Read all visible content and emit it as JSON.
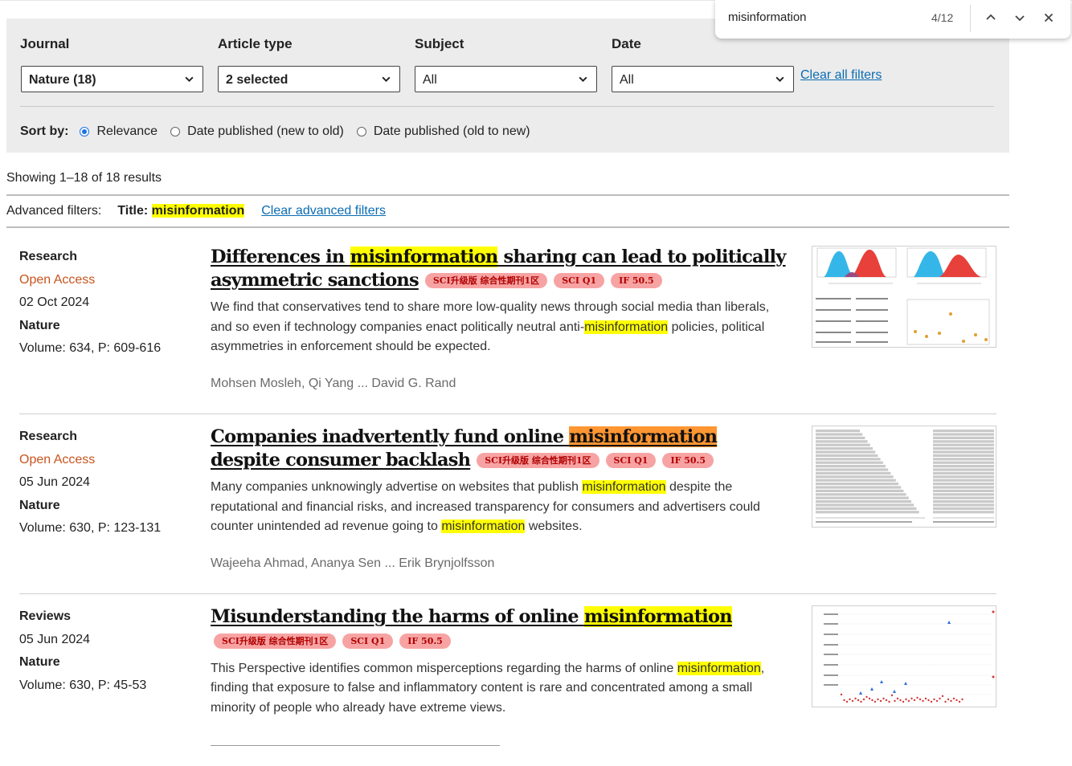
{
  "find_bar": {
    "query": "misinformation",
    "count": "4/12"
  },
  "filters": {
    "journal": {
      "label": "Journal",
      "value": "Nature (18)"
    },
    "article_type": {
      "label": "Article type",
      "value": "2 selected"
    },
    "subject": {
      "label": "Subject",
      "value": "All"
    },
    "date": {
      "label": "Date",
      "value": "All"
    },
    "clear_all": "Clear all filters",
    "sort_by_label": "Sort by:",
    "sort_options": [
      "Relevance",
      "Date published (new to old)",
      "Date published (old to new)"
    ],
    "sort_selected": "Relevance"
  },
  "results_summary": "Showing 1–18 of 18 results",
  "advanced_filters": {
    "label": "Advanced filters:",
    "title_label": "Title:",
    "title_value": "misinformation",
    "clear": "Clear advanced filters"
  },
  "articles": [
    {
      "type": "Research",
      "access": "Open Access",
      "date": "02 Oct 2024",
      "journal": "Nature",
      "volume": "Volume: 634, P: 609-616",
      "title_before": "Differences in ",
      "title_highlight": "misinformation",
      "title_after": " sharing can lead to politically asymmetric sanctions",
      "badges": [
        "SCI升级版 综合性期刊1区",
        "SCI Q1",
        "IF 50.5"
      ],
      "summary_1": "We find that conservatives tend to share more low-quality news through social media than liberals, and so even if technology companies enact politically neutral anti-",
      "summary_hl_1": "misinformation",
      "summary_2": " policies, political asymmetries in enforcement should be expected.",
      "authors": "Mohsen Mosleh, Qi Yang ... David G. Rand",
      "thumbnail": "density-plots-and-table-figure"
    },
    {
      "type": "Research",
      "access": "Open Access",
      "date": "05 Jun 2024",
      "journal": "Nature",
      "volume": "Volume: 630, P: 123-131",
      "title_before": "Companies inadvertently fund online ",
      "title_highlight": "misinformation",
      "title_after": " despite consumer backlash",
      "badges": [
        "SCI升级版 综合性期刊1区",
        "SCI Q1",
        "IF 50.5"
      ],
      "summary_1": "Many companies unknowingly advertise on websites that publish ",
      "summary_hl_1": "misinformation",
      "summary_2": " despite the reputational and financial risks, and increased transparency for consumers and advertisers could counter unintended ad revenue going to ",
      "summary_hl_2": "misinformation",
      "summary_3": " websites.",
      "authors": "Wajeeha Ahmad, Ananya Sen ... Erik Brynjolfsson",
      "thumbnail": "horizontal-bar-chart-figure"
    },
    {
      "type": "Reviews",
      "date": "05 Jun 2024",
      "journal": "Nature",
      "volume": "Volume: 630, P: 45-53",
      "title_before": "Misunderstanding the harms of online ",
      "title_highlight": "misinformation",
      "badges": [
        "SCI升级版 综合性期刊1区",
        "SCI Q1",
        "IF 50.5"
      ],
      "summary_1": "This Perspective identifies common misperceptions regarding the harms of online ",
      "summary_hl_1": "misinformation",
      "summary_2": ", finding that exposure to false and inflammatory content is rare and concentrated among a small minority of people who already have extreme views.",
      "thumbnail": "scatter-plot-figure"
    }
  ],
  "colors": {
    "highlight": "#ffff00",
    "current_highlight": "#ff9632",
    "link": "#0a6cb3",
    "open_access": "#c8541e",
    "badge_bg": "#f7a3a3",
    "badge_text": "#b00000",
    "filter_panel": "#ececec"
  }
}
